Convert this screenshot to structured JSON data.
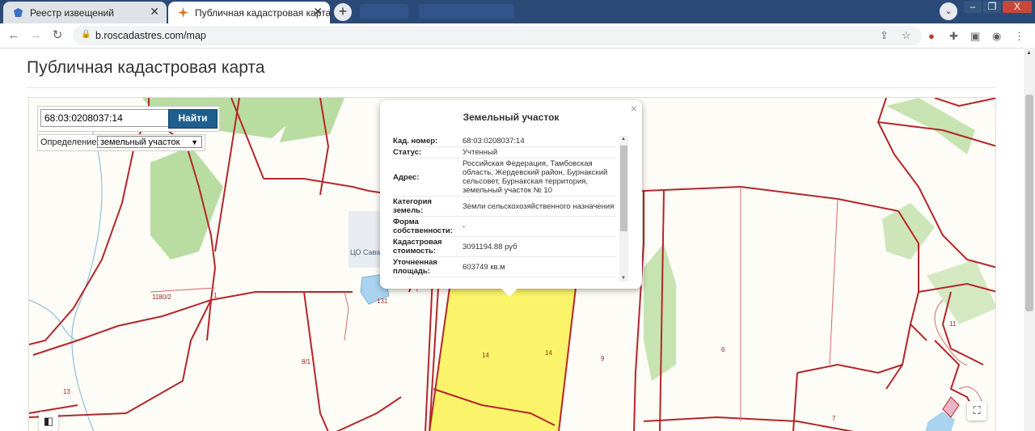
{
  "browser": {
    "tabs": [
      {
        "title": "Реестр извещений",
        "active": false
      },
      {
        "title": "Публичная кадастровая карта",
        "active": true
      }
    ],
    "new_tab_icon": "+",
    "url": "b.roscadastres.com/map",
    "window_controls": {
      "minimize": "–",
      "maximize": "❐",
      "close": "X"
    }
  },
  "page": {
    "title": "Публичная кадастровая карта"
  },
  "search": {
    "value": "68:03:0208037:14",
    "button": "Найти",
    "definition_label": "Определение:",
    "definition_value": "земельный участок"
  },
  "popup": {
    "title": "Земельный участок",
    "close": "×",
    "rows": [
      {
        "key": "Кад. номер:",
        "value": "68:03:0208037:14"
      },
      {
        "key": "Статус:",
        "value": "Учтенный"
      },
      {
        "key": "Адрес:",
        "value": "Российская Федерация, Тамбовская область, Жердевский район, Бурнакский сельсовет, Бурнакская территория, земельный участок № 10"
      },
      {
        "key": "Категория земель:",
        "value": "Земли сельскохозяйственного назначения"
      },
      {
        "key": "Форма собственности:",
        "value": "-"
      },
      {
        "key": "Кадастровая стоимость:",
        "value": "3091194.88 руб"
      },
      {
        "key": "Уточненная площадь:",
        "value": "603749 кв.м"
      }
    ]
  },
  "map": {
    "poi_label": "ЦО Сава",
    "parcel_labels": {
      "p1180": "1180/2",
      "p1": "1",
      "p131": "131",
      "p81": "8/1",
      "p13": "13",
      "p14a": "14",
      "p14b": "14",
      "p9": "9",
      "p6": "6",
      "p7": "7",
      "p11": "11"
    },
    "colors": {
      "boundary": "#b3262a",
      "forest": "#b9dca0",
      "selected": "#fbf46a",
      "water": "#a9d3ee"
    }
  }
}
